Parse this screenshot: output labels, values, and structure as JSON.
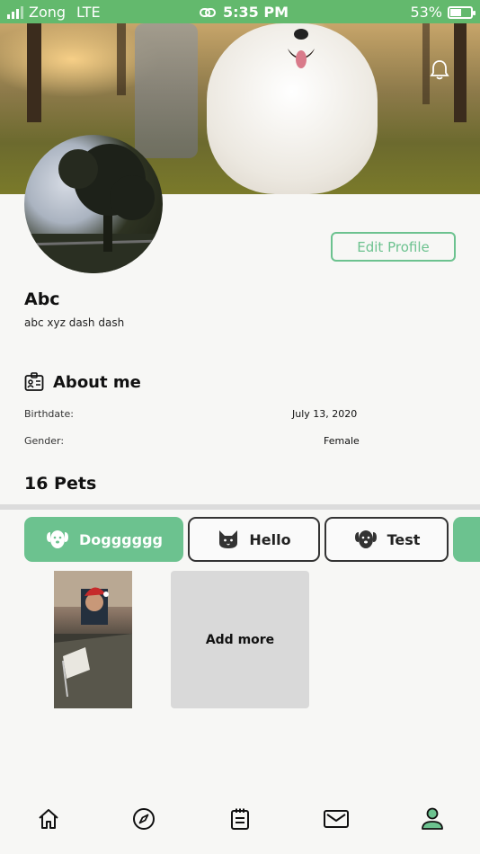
{
  "status_bar": {
    "carrier": "Zong",
    "network": "LTE",
    "time": "5:35 PM",
    "battery": "53%",
    "battery_level": 0.53
  },
  "profile": {
    "name": "Abc",
    "bio": "abc xyz dash dash",
    "edit_label": "Edit Profile"
  },
  "about": {
    "title": "About me",
    "rows": [
      {
        "label": "Birthdate:",
        "value": "July 13, 2020"
      },
      {
        "label": "Gender:",
        "value": "Female"
      }
    ]
  },
  "pets": {
    "title": "16 Pets",
    "tabs": [
      {
        "label": "Dogggggg",
        "icon": "dog-icon",
        "active": true
      },
      {
        "label": "Hello",
        "icon": "cat-icon",
        "active": false
      },
      {
        "label": "Test",
        "icon": "dog-icon",
        "active": false
      }
    ],
    "add_more_label": "Add more"
  },
  "nav": [
    "home-icon",
    "compass-icon",
    "notepad-icon",
    "mail-icon",
    "profile-icon"
  ],
  "colors": {
    "accent": "#6cc28f",
    "status_bar": "#63b96d"
  }
}
